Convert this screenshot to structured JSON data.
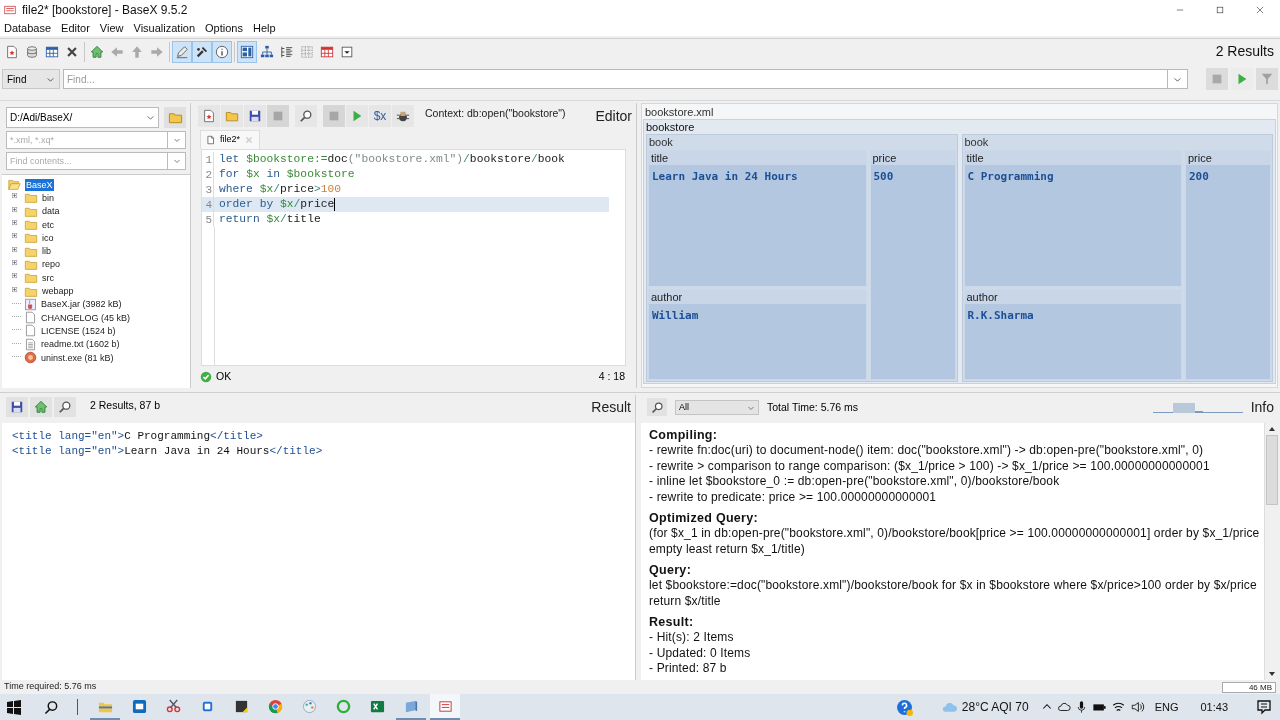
{
  "window": {
    "title": "file2* [bookstore] - BaseX 9.5.2"
  },
  "menu": [
    "Database",
    "Editor",
    "View",
    "Visualization",
    "Options",
    "Help"
  ],
  "toolbar_groups": [
    [
      {
        "kind": "newfile",
        "selected": false,
        "disabled": false
      },
      {
        "kind": "database",
        "selected": false,
        "disabled": false
      },
      {
        "kind": "table",
        "selected": false,
        "disabled": false
      },
      {
        "kind": "close",
        "selected": false,
        "disabled": false
      }
    ],
    [
      {
        "kind": "home",
        "selected": false,
        "disabled": false
      },
      {
        "kind": "back",
        "selected": false,
        "disabled": true
      },
      {
        "kind": "up",
        "selected": false,
        "disabled": true
      },
      {
        "kind": "forward",
        "selected": false,
        "disabled": true
      }
    ],
    [
      {
        "kind": "edit",
        "selected": true,
        "disabled": false
      },
      {
        "kind": "tools",
        "selected": true,
        "disabled": false
      },
      {
        "kind": "info",
        "selected": true,
        "disabled": false
      }
    ],
    [
      {
        "kind": "map",
        "selected": true,
        "disabled": false
      },
      {
        "kind": "tree",
        "selected": false,
        "disabled": false
      },
      {
        "kind": "list",
        "selected": false,
        "disabled": false
      },
      {
        "kind": "grid",
        "selected": false,
        "disabled": false
      },
      {
        "kind": "redtable",
        "selected": false,
        "disabled": false
      },
      {
        "kind": "more",
        "selected": false,
        "disabled": false
      }
    ]
  ],
  "results_count": "2 Results",
  "find_bar": {
    "mode": "Find",
    "placeholder": "Find...",
    "buttons": [
      {
        "kind": "stop",
        "disabled": true
      },
      {
        "kind": "run",
        "disabled": false
      },
      {
        "kind": "filter",
        "disabled": true
      }
    ]
  },
  "project": {
    "path": "D:/Adi/BaseX/",
    "filter_placeholder": "*.xml, *.xq*",
    "search_placeholder": "Find contents...",
    "tree": [
      {
        "label": "BaseX",
        "kind": "folder",
        "expanded": true,
        "selected": true,
        "children": [
          {
            "label": "bin",
            "kind": "folder",
            "expanded": false,
            "selected": false
          },
          {
            "label": "data",
            "kind": "folder",
            "expanded": false,
            "selected": false
          },
          {
            "label": "etc",
            "kind": "folder",
            "expanded": false,
            "selected": false
          },
          {
            "label": "ico",
            "kind": "folder",
            "expanded": false,
            "selected": false
          },
          {
            "label": "lib",
            "kind": "folder",
            "expanded": false,
            "selected": false
          },
          {
            "label": "repo",
            "kind": "folder",
            "expanded": false,
            "selected": false
          },
          {
            "label": "src",
            "kind": "folder",
            "expanded": false,
            "selected": false
          },
          {
            "label": "webapp",
            "kind": "folder",
            "expanded": false,
            "selected": false
          },
          {
            "label": "BaseX.jar (3982 kB)",
            "kind": "jar",
            "selected": false
          },
          {
            "label": "CHANGELOG (45 kB)",
            "kind": "document",
            "selected": false
          },
          {
            "label": "LICENSE (1524 b)",
            "kind": "document",
            "selected": false
          },
          {
            "label": "readme.txt (1602 b)",
            "kind": "text",
            "selected": false
          },
          {
            "label": "uninst.exe (81 kB)",
            "kind": "exe",
            "selected": false
          }
        ]
      }
    ]
  },
  "editor": {
    "title": "Editor",
    "context": "Context: db:open(\"bookstore\")",
    "buttons": [
      {
        "kind": "newfile",
        "disabled": false
      },
      {
        "kind": "open",
        "disabled": false
      },
      {
        "kind": "save",
        "disabled": false
      },
      {
        "kind": "stop",
        "disabled": true
      },
      {
        "kind": "find",
        "disabled": false
      },
      {
        "kind": "stop",
        "disabled": true
      },
      {
        "kind": "run",
        "disabled": false
      },
      {
        "kind": "vars",
        "label": "$x",
        "disabled": false
      },
      {
        "kind": "debug",
        "disabled": false
      }
    ],
    "tabs": [
      {
        "label": "file2*",
        "selected": true
      }
    ],
    "lines": [
      {
        "number": "1",
        "current": false,
        "tokens": [
          {
            "kind": "keyword",
            "text": "let "
          },
          {
            "kind": "variable",
            "text": "$bookstore:="
          },
          {
            "kind": "name",
            "text": "doc"
          },
          {
            "kind": "string",
            "text": "(\"bookstore.xml\")"
          },
          {
            "kind": "operator",
            "text": "/"
          },
          {
            "kind": "name",
            "text": "bookstore"
          },
          {
            "kind": "operator",
            "text": "/"
          },
          {
            "kind": "name",
            "text": "book"
          }
        ]
      },
      {
        "number": "2",
        "current": false,
        "tokens": [
          {
            "kind": "keyword",
            "text": "for "
          },
          {
            "kind": "variable",
            "text": "$x"
          },
          {
            "kind": "keyword",
            "text": " in "
          },
          {
            "kind": "variable",
            "text": "$bookstore"
          }
        ]
      },
      {
        "number": "3",
        "current": false,
        "tokens": [
          {
            "kind": "keyword",
            "text": "where "
          },
          {
            "kind": "variable",
            "text": "$x"
          },
          {
            "kind": "operator",
            "text": "/"
          },
          {
            "kind": "name",
            "text": "price"
          },
          {
            "kind": "operator",
            "text": ">"
          },
          {
            "kind": "number",
            "text": "100"
          }
        ]
      },
      {
        "number": "4",
        "current": true,
        "tokens": [
          {
            "kind": "keyword",
            "text": "order by "
          },
          {
            "kind": "variable",
            "text": "$x"
          },
          {
            "kind": "operator",
            "text": "/"
          },
          {
            "kind": "name",
            "text": "price"
          }
        ]
      },
      {
        "number": "5",
        "current": false,
        "tokens": [
          {
            "kind": "keyword",
            "text": "return "
          },
          {
            "kind": "variable",
            "text": "$x"
          },
          {
            "kind": "operator",
            "text": "/"
          },
          {
            "kind": "name",
            "text": "title"
          }
        ]
      }
    ],
    "status": "OK",
    "position": "4 : 18"
  },
  "map": {
    "file": "bookstore.xml",
    "root": "bookstore",
    "books": [
      {
        "label": "book",
        "title": {
          "label": "title",
          "value": "Learn Java in 24 Hours"
        },
        "author": {
          "label": "author",
          "value": "William"
        },
        "price": {
          "label": "price",
          "value": "500"
        }
      },
      {
        "label": "book",
        "title": {
          "label": "title",
          "value": "C Programming"
        },
        "author": {
          "label": "author",
          "value": "R.K.Sharma"
        },
        "price": {
          "label": "price",
          "value": "200"
        }
      }
    ]
  },
  "result": {
    "title": "Result",
    "summary": "2 Results, 87 b",
    "buttons": [
      {
        "kind": "save"
      },
      {
        "kind": "home"
      },
      {
        "kind": "find"
      }
    ],
    "lines": [
      [
        {
          "kind": "tag",
          "text": "<title lang=\"en\">"
        },
        {
          "kind": "text",
          "text": "C Programming"
        },
        {
          "kind": "tag",
          "text": "</title>"
        }
      ],
      [
        {
          "kind": "tag",
          "text": "<title lang=\"en\">"
        },
        {
          "kind": "text",
          "text": "Learn Java in 24 Hours"
        },
        {
          "kind": "tag",
          "text": "</title>"
        }
      ]
    ]
  },
  "info": {
    "title": "Info",
    "filter": "All",
    "total_time": "Total Time: 5.76 ms",
    "sections": [
      {
        "heading": "Compiling:",
        "lines": [
          "- rewrite fn:doc(uri) to document-node() item: doc(\"bookstore.xml\") -> db:open-pre(\"bookstore.xml\", 0)",
          "- rewrite > comparison to range comparison: ($x_1/price > 100) -> $x_1/price >= 100.00000000000001",
          "- inline let $bookstore_0 := db:open-pre(\"bookstore.xml\", 0)/bookstore/book",
          "- rewrite to predicate: price >= 100.00000000000001"
        ]
      },
      {
        "heading": "Optimized Query:",
        "lines": [
          "(for $x_1 in db:open-pre(\"bookstore.xml\", 0)/bookstore/book[price >= 100.00000000000001] order by $x_1/price empty least return $x_1/title)"
        ]
      },
      {
        "heading": "Query:",
        "lines": [
          "let $bookstore:=doc(\"bookstore.xml\")/bookstore/book for $x in $bookstore where $x/price>100 order by $x/price return $x/title"
        ]
      },
      {
        "heading": "Result:",
        "lines": [
          "- Hit(s): 2 Items",
          "- Updated: 0 Items",
          "- Printed: 87 b"
        ]
      }
    ]
  },
  "status_bar": {
    "text": "Time required: 5.76 ms",
    "memory": "46 MB"
  },
  "taskbar": {
    "apps": [
      {
        "kind": "folder",
        "running": true,
        "selected": false
      },
      {
        "kind": "mail",
        "running": false,
        "selected": false
      },
      {
        "kind": "snip",
        "running": false,
        "selected": false
      },
      {
        "kind": "blue",
        "running": false,
        "selected": false
      },
      {
        "kind": "notes",
        "running": false,
        "selected": false
      },
      {
        "kind": "browser",
        "running": false,
        "selected": false
      },
      {
        "kind": "paint",
        "running": false,
        "selected": false
      },
      {
        "kind": "ring",
        "running": false,
        "selected": false
      },
      {
        "kind": "sheet",
        "running": false,
        "selected": false
      },
      {
        "kind": "window",
        "running": true,
        "selected": false
      },
      {
        "kind": "basex",
        "running": true,
        "selected": true
      }
    ],
    "weather": "28°C AQI 70",
    "language": "ENG",
    "time": "01:43"
  }
}
